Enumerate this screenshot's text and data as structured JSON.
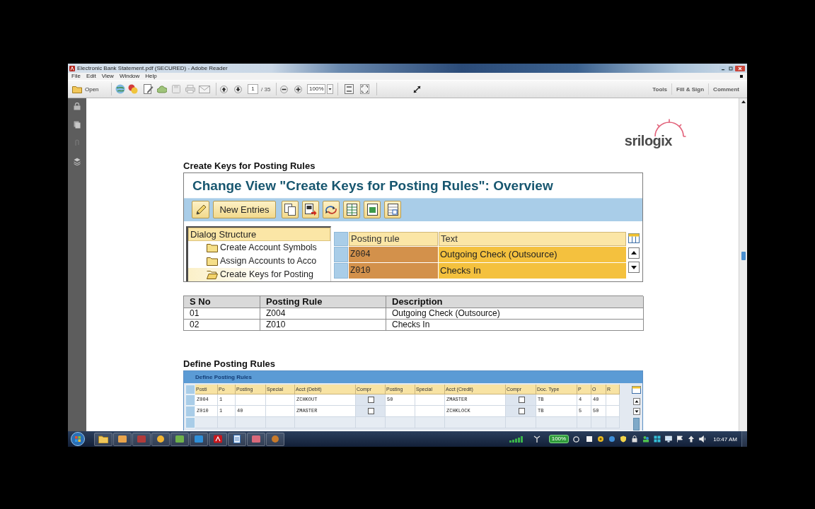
{
  "window": {
    "title": "Electronic Bank Statement.pdf (SECURED) - Adobe Reader"
  },
  "menu": [
    "File",
    "Edit",
    "View",
    "Window",
    "Help"
  ],
  "toolbar": {
    "open": "Open",
    "page": "1",
    "page_total": "/ 35",
    "zoom": "100%",
    "panes": [
      "Tools",
      "Fill & Sign",
      "Comment"
    ]
  },
  "document": {
    "logo": "srilogix",
    "create_keys": {
      "heading": "Create Keys for Posting Rules",
      "screen": {
        "title": "Change View \"Create Keys for Posting Rules\": Overview",
        "new_entries": "New Entries",
        "dialog_structure": {
          "title": "Dialog Structure",
          "items": [
            {
              "label": "Create Account Symbols",
              "selected": false
            },
            {
              "label": "Assign Accounts to Acco",
              "selected": false
            },
            {
              "label": "Create Keys for Posting",
              "selected": true
            }
          ]
        },
        "columns": [
          {
            "label": "Posting rule",
            "kind": "key"
          },
          {
            "label": "Text",
            "kind": "text"
          }
        ],
        "rows": [
          [
            "Z004",
            "Outgoing Check (Outsource)"
          ],
          [
            "Z010",
            "Checks In"
          ]
        ]
      }
    },
    "summary_table": {
      "columns": [
        "S No",
        "Posting Rule",
        "Description"
      ],
      "rows": [
        [
          "01",
          "Z004",
          "Outgoing Check (Outsource)"
        ],
        [
          "02",
          "Z010",
          "Checks In"
        ]
      ]
    },
    "define_rules": {
      "heading": "Define Posting Rules",
      "screen": {
        "title": "Define Posting Rules",
        "columns": [
          {
            "label": "Posti",
            "kind": "text"
          },
          {
            "label": "Po",
            "kind": "text"
          },
          {
            "label": "Posting",
            "kind": "text"
          },
          {
            "label": "Special",
            "kind": "text"
          },
          {
            "label": "Acct (Debit)",
            "kind": "text"
          },
          {
            "label": "Compr",
            "kind": "checkbox"
          },
          {
            "label": "Posting",
            "kind": "text"
          },
          {
            "label": "Special",
            "kind": "text"
          },
          {
            "label": "Acct (Credit)",
            "kind": "text"
          },
          {
            "label": "Compr",
            "kind": "checkbox"
          },
          {
            "label": "Doc. Type",
            "kind": "text"
          },
          {
            "label": "P",
            "kind": "text"
          },
          {
            "label": "O",
            "kind": "text"
          },
          {
            "label": "R",
            "kind": "text"
          }
        ],
        "rows": [
          [
            "Z004",
            "1",
            null,
            null,
            "ZCHKOUT",
            {
              "checked": false
            },
            "50",
            null,
            "ZMASTER",
            {
              "checked": false
            },
            "TB",
            "4",
            "40",
            null
          ],
          [
            "Z010",
            "1",
            "40",
            null,
            "ZMASTER",
            {
              "checked": false
            },
            null,
            null,
            "ZCHKLOCK",
            {
              "checked": false
            },
            "TB",
            "5",
            "50",
            null
          ]
        ]
      }
    }
  },
  "taskbar": {
    "battery": "100%",
    "clock": "10:47 AM"
  }
}
